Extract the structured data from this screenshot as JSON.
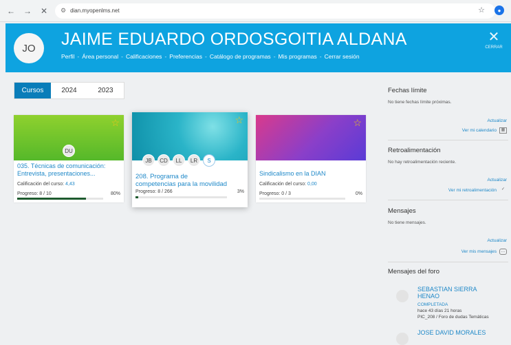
{
  "browser": {
    "url": "dian.myopenlms.net",
    "icons": [
      "back-arrow-icon",
      "forward-arrow-icon",
      "close-icon",
      "site-info-icon",
      "star-icon",
      "profile-icon"
    ]
  },
  "header": {
    "initials": "JO",
    "name": "JAIME EDUARDO ORDOSGOITIA ALDANA",
    "menu": [
      "Perfil",
      "Área personal",
      "Calificaciones",
      "Preferencias",
      "Catálogo de programas",
      "Mis programas",
      "Cerrar sesión"
    ],
    "close_label": "CERRAR",
    "color": "#0ea3e0"
  },
  "tabs": [
    {
      "label": "Cursos",
      "active": true
    },
    {
      "label": "2024",
      "active": false
    },
    {
      "label": "2023",
      "active": false
    }
  ],
  "courses": [
    {
      "title_line1": "035. Técnicas de comunicación:",
      "title_line2": "Entrevista, presentaciones...",
      "avatars": [
        "DU"
      ],
      "grade_label": "Calificación del curso:",
      "grade_value": "4,43",
      "progress_label": "Progreso: 8 / 10",
      "progress_pct": "80%",
      "progress": 0.8
    },
    {
      "title_line1": "208. Programa de",
      "title_line2": "competencias para la movilidad",
      "avatars": [
        "JB",
        "CD",
        "LL",
        "LR",
        "S"
      ],
      "grade_label": "",
      "grade_value": "",
      "progress_label": "Progreso: 8 / 266",
      "progress_pct": "3%",
      "progress": 0.03
    },
    {
      "title_line1": "Sindicalismo en la DIAN",
      "title_line2": "",
      "avatars": [],
      "grade_label": "Calificación del curso:",
      "grade_value": "0,00",
      "progress_label": "Progreso: 0 / 3",
      "progress_pct": "0%",
      "progress": 0
    }
  ],
  "sidebar": {
    "deadlines": {
      "title": "Fechas límite",
      "text": "No tiene fechas límite próximas.",
      "refresh": "Actualizar",
      "link": "Ver mi calendario"
    },
    "feedback": {
      "title": "Retroalimentación",
      "text": "No hay retroalimentación reciente.",
      "refresh": "Actualizar",
      "link": "Ver mi retroalimentación"
    },
    "messages": {
      "title": "Mensajes",
      "text": "No tiene mensajes.",
      "refresh": "Actualizar",
      "link": "Ver mis mensajes"
    },
    "forum": {
      "title": "Mensajes del foro",
      "items": [
        {
          "name_line1": "SEBASTIAN SIERRA",
          "name_line2": "HENAO",
          "status": "COMPLETADA",
          "time": "hace 43 días 21 horas",
          "place": "PIC_208 / Foro de dudas Temáticas"
        },
        {
          "name_line1": "JOSE DAVID MORALES",
          "name_line2": "",
          "status": "",
          "time": "",
          "place": ""
        }
      ]
    }
  }
}
